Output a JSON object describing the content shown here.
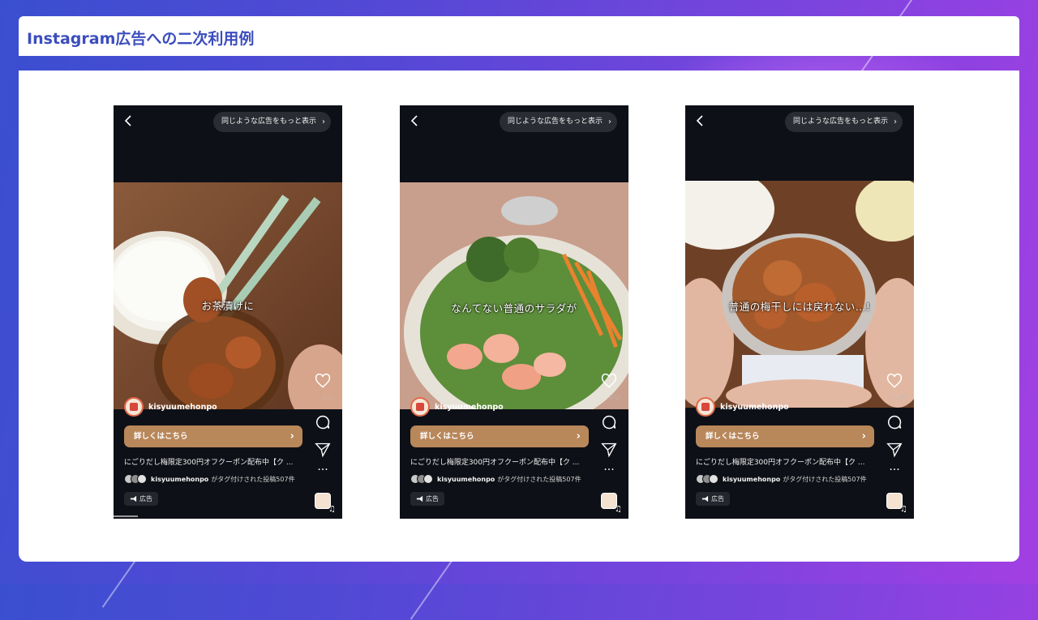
{
  "slide": {
    "title": "Instagram広告への二次利用例"
  },
  "phones": [
    {
      "more_ads_label": "同じような広告をもっと表示",
      "caption": "お茶漬けに",
      "likes_label": "いい",
      "account_name": "kisyuumehonpo",
      "cta_label": "詳しくはこちら",
      "ad_text": "にごりだし梅限定300円オフクーポン配布中【ク ...",
      "tagged_user": "kisyuumehonpo",
      "tagged_suffix": "がタグ付けされた投稿507件",
      "ad_badge": "広告"
    },
    {
      "more_ads_label": "同じような広告をもっと表示",
      "caption": "なんてない普通のサラダが",
      "likes_label": "いい",
      "account_name": "kisyuumehonpo",
      "cta_label": "詳しくはこちら",
      "ad_text": "にごりだし梅限定300円オフクーポン配布中【ク ...",
      "tagged_user": "kisyuumehonpo",
      "tagged_suffix": "がタグ付けされた投稿507件",
      "ad_badge": "広告"
    },
    {
      "more_ads_label": "同じような広告をもっと表示",
      "caption": "普通の梅干しには戻れない…!",
      "likes_label": "いいね",
      "account_name": "kisyuumehonpo",
      "cta_label": "詳しくはこちら",
      "ad_text": "にごりだし梅限定300円オフクーポン配布中【ク ...",
      "tagged_user": "kisyuumehonpo",
      "tagged_suffix": "がタグ付けされた投稿507件",
      "ad_badge": "広告"
    }
  ],
  "icons": {
    "back": "chevron-left-icon",
    "more_ads_chevron": "chevron-right-icon",
    "like": "heart-icon",
    "comment": "comment-icon",
    "share": "send-icon",
    "more": "more-icon",
    "ad": "megaphone-icon",
    "music": "music-icon"
  },
  "colors": {
    "title": "#3b4dbe",
    "cta": "#b8875a",
    "phone_bg": "#0e1017"
  }
}
